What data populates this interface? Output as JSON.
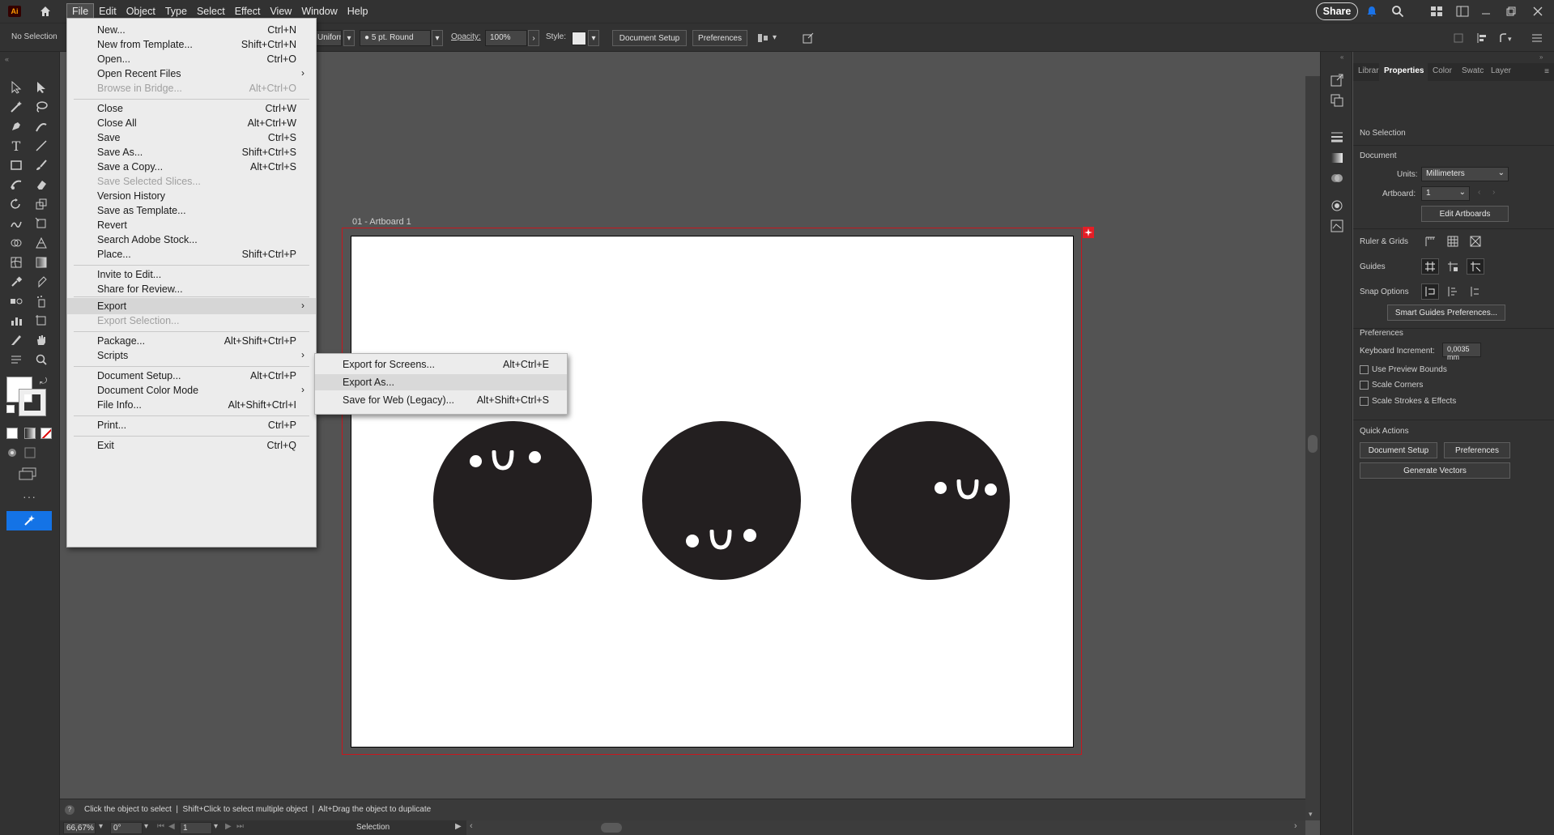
{
  "app": {
    "logo": "Ai"
  },
  "menubar": {
    "items": [
      "File",
      "Edit",
      "Object",
      "Type",
      "Select",
      "Effect",
      "View",
      "Window",
      "Help"
    ],
    "share_label": "Share"
  },
  "controlbar": {
    "selection_status": "No Selection",
    "stroke_profile": "Uniform",
    "brush": "5 pt. Round",
    "opacity_label": "Opacity:",
    "opacity_value": "100%",
    "style_label": "Style:",
    "doc_setup_label": "Document Setup",
    "preferences_label": "Preferences"
  },
  "file_menu": {
    "items": [
      {
        "label": "New...",
        "shortcut": "Ctrl+N"
      },
      {
        "label": "New from Template...",
        "shortcut": "Shift+Ctrl+N"
      },
      {
        "label": "Open...",
        "shortcut": "Ctrl+O"
      },
      {
        "label": "Open Recent Files",
        "shortcut": ""
      },
      {
        "label": "Browse in Bridge...",
        "shortcut": "Alt+Ctrl+O"
      },
      {
        "label": "Close",
        "shortcut": "Ctrl+W"
      },
      {
        "label": "Close All",
        "shortcut": "Alt+Ctrl+W"
      },
      {
        "label": "Save",
        "shortcut": "Ctrl+S"
      },
      {
        "label": "Save As...",
        "shortcut": "Shift+Ctrl+S"
      },
      {
        "label": "Save a Copy...",
        "shortcut": "Alt+Ctrl+S"
      },
      {
        "label": "Save Selected Slices...",
        "shortcut": ""
      },
      {
        "label": "Version History",
        "shortcut": ""
      },
      {
        "label": "Save as Template...",
        "shortcut": ""
      },
      {
        "label": "Revert",
        "shortcut": ""
      },
      {
        "label": "Search Adobe Stock...",
        "shortcut": ""
      },
      {
        "label": "Place...",
        "shortcut": "Shift+Ctrl+P"
      },
      {
        "label": "Invite to Edit...",
        "shortcut": ""
      },
      {
        "label": "Share for Review...",
        "shortcut": ""
      },
      {
        "label": "Export",
        "shortcut": ""
      },
      {
        "label": "Export Selection...",
        "shortcut": ""
      },
      {
        "label": "Package...",
        "shortcut": "Alt+Shift+Ctrl+P"
      },
      {
        "label": "Scripts",
        "shortcut": ""
      },
      {
        "label": "Document Setup...",
        "shortcut": "Alt+Ctrl+P"
      },
      {
        "label": "Document Color Mode",
        "shortcut": ""
      },
      {
        "label": "File Info...",
        "shortcut": "Alt+Shift+Ctrl+I"
      },
      {
        "label": "Print...",
        "shortcut": "Ctrl+P"
      },
      {
        "label": "Exit",
        "shortcut": "Ctrl+Q"
      }
    ]
  },
  "export_submenu": {
    "items": [
      {
        "label": "Export for Screens...",
        "shortcut": "Alt+Ctrl+E"
      },
      {
        "label": "Export As...",
        "shortcut": ""
      },
      {
        "label": "Save for Web (Legacy)...",
        "shortcut": "Alt+Shift+Ctrl+S"
      }
    ]
  },
  "canvas": {
    "artboard_label": "01 - Artboard 1"
  },
  "statusbar": {
    "hint": "Click the object to select  |  Shift+Click to select multiple object  |  Alt+Drag the object to duplicate",
    "zoom": "66,67%",
    "rotation": "0°",
    "artboard_num": "1",
    "tool": "Selection"
  },
  "properties": {
    "tabs": [
      "Librar",
      "Properties",
      "Color",
      "Swatc",
      "Layer"
    ],
    "selection": "No Selection",
    "document_heading": "Document",
    "units_label": "Units:",
    "units_value": "Millimeters",
    "artboard_label": "Artboard:",
    "artboard_value": "1",
    "edit_artboards": "Edit Artboards",
    "ruler_grids": "Ruler & Grids",
    "guides": "Guides",
    "snap_options": "Snap Options",
    "smart_guides_btn": "Smart Guides Preferences...",
    "preferences_heading": "Preferences",
    "keyboard_increment_label": "Keyboard Increment:",
    "keyboard_increment_value": "0,0035 mm",
    "use_preview_bounds": "Use Preview Bounds",
    "scale_corners": "Scale Corners",
    "scale_strokes": "Scale Strokes & Effects",
    "quick_actions": "Quick Actions",
    "qa_doc_setup": "Document Setup",
    "qa_preferences": "Preferences",
    "qa_generate_vectors": "Generate Vectors"
  },
  "colors": {
    "menu_bg": "#ececec",
    "ui_dark": "#323232",
    "canvas": "#535353",
    "artboard_border": "#c8171e",
    "face": "#231f20"
  }
}
